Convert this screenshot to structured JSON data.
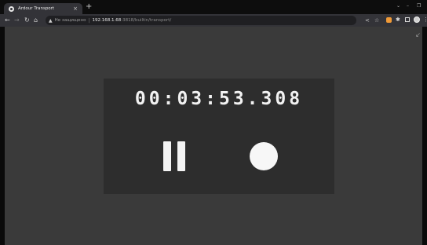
{
  "browser": {
    "tab_title": "Ardour Transport",
    "tab_close": "×",
    "new_tab": "+",
    "url_warning_icon": "warning-triangle",
    "url_security_label": "Не защищено",
    "url_separator": "|",
    "url_host": "192.168.1.68",
    "url_rest": ":3818/builtin/transport/"
  },
  "transport": {
    "clock": "00:03:53.308",
    "pause_icon": "pause-icon",
    "record_icon": "record-icon"
  },
  "colors": {
    "background": "#3a3a3a",
    "panel": "#2d2d2d",
    "foreground": "#f4f4f4"
  }
}
